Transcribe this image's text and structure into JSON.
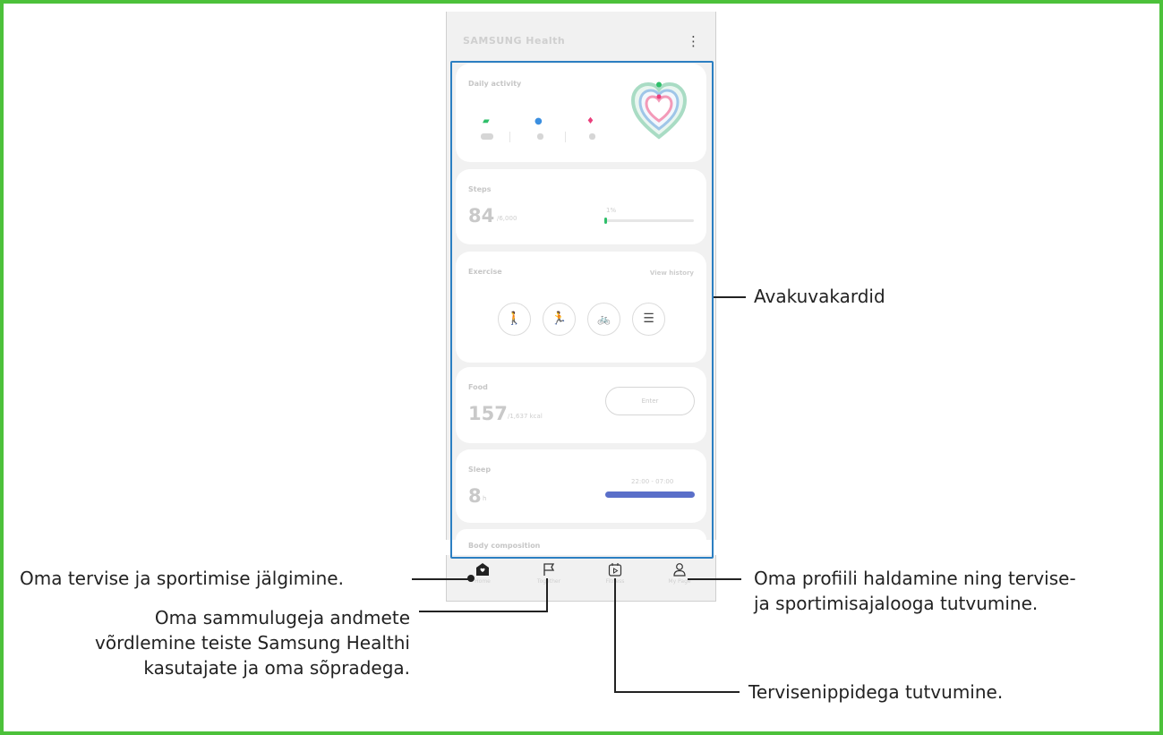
{
  "app": {
    "title": "SAMSUNG Health"
  },
  "cards": {
    "daily_activity": {
      "title": "Daily activity",
      "values": [
        "152",
        "8",
        "8"
      ]
    },
    "steps": {
      "title": "Steps",
      "value": "84",
      "goal": "/6,000",
      "progress_label": "1%",
      "progress": 0.01
    },
    "exercise": {
      "title": "Exercise",
      "link": "View history",
      "buttons": [
        "walking",
        "running",
        "cycling",
        "more"
      ]
    },
    "food": {
      "title": "Food",
      "value": "157",
      "goal": "/1,637 kcal",
      "button": "Enter"
    },
    "sleep": {
      "title": "Sleep",
      "value": "8",
      "unit": "h",
      "range": "22:00 - 07:00"
    },
    "body_composition": {
      "title": "Body composition"
    }
  },
  "nav": {
    "items": [
      {
        "label": "Home",
        "icon": "home-icon"
      },
      {
        "label": "Together",
        "icon": "flag-icon"
      },
      {
        "label": "Fitness",
        "icon": "play-calendar-icon"
      },
      {
        "label": "My Page",
        "icon": "person-icon"
      }
    ]
  },
  "callouts": {
    "home_cards": "Avakuvakardid",
    "home": "Oma tervise ja sportimise jälgimine.",
    "together_line1": "Oma sammulugeja andmete",
    "together_line2": "võrdlemine teiste Samsung Healthi",
    "together_line3": "kasutajate ja oma sõpradega.",
    "fitness": "Tervisenippidega tutvumine.",
    "mypage_line1": "Oma profiili haldamine ning tervise-",
    "mypage_line2": "ja sportimisajalooga tutvumine."
  },
  "colors": {
    "frame": "#4cc13a",
    "highlight": "#2c7fc2",
    "steps_accent": "#2fbf6a",
    "sleep_bar": "#5a6fc9",
    "heart_outer": "#a9dcc4",
    "heart_middle": "#9fc6e8",
    "heart_inner": "#f39ab8"
  }
}
